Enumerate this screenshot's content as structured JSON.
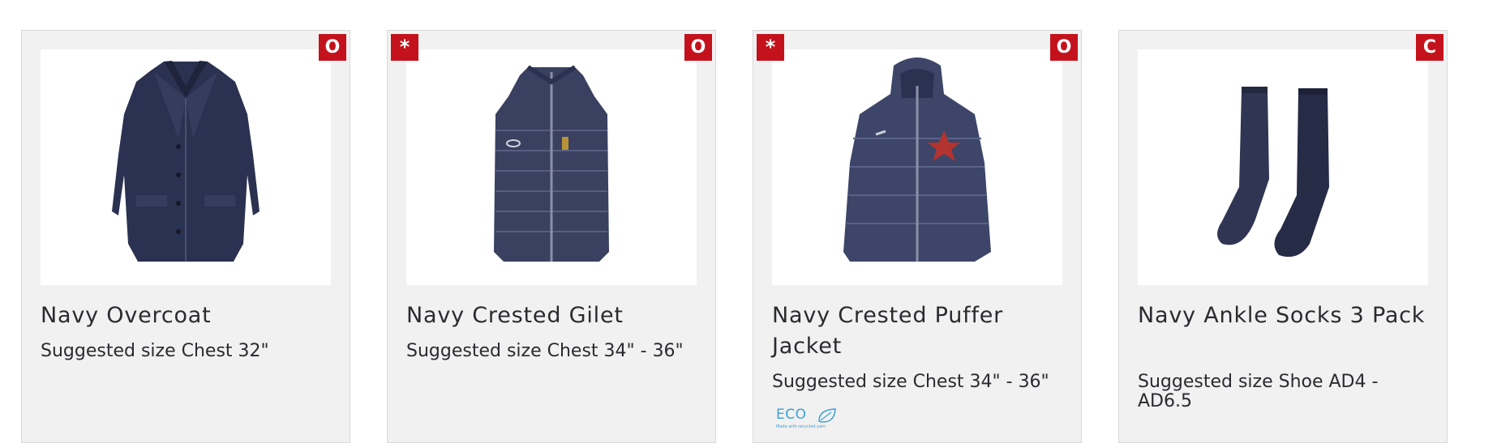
{
  "products": [
    {
      "title": "Navy Overcoat",
      "size": "Suggested size Chest 32\"",
      "badge_right": "O",
      "badge_left": null,
      "image_icon": "overcoat-image"
    },
    {
      "title": "Navy Crested Gilet",
      "size": "Suggested size Chest 34\" - 36\"",
      "badge_right": "O",
      "badge_left": "*",
      "image_icon": "gilet-image"
    },
    {
      "title": "Navy Crested Puffer Jacket",
      "size": "Suggested size Chest 34\" - 36\"",
      "badge_right": "O",
      "badge_left": "*",
      "eco_label": "ECO",
      "eco_sub": "Made with recycled yarn",
      "image_icon": "puffer-jacket-image"
    },
    {
      "title": "Navy Ankle Socks 3 Pack",
      "size": "Suggested size Shoe AD4 - AD6.5",
      "badge_right": "C",
      "badge_left": null,
      "image_icon": "socks-image"
    }
  ],
  "colors": {
    "badge": "#c4121c",
    "card_bg": "#f1f1f1",
    "navy": "#2b3150",
    "eco": "#3aa0d6"
  }
}
